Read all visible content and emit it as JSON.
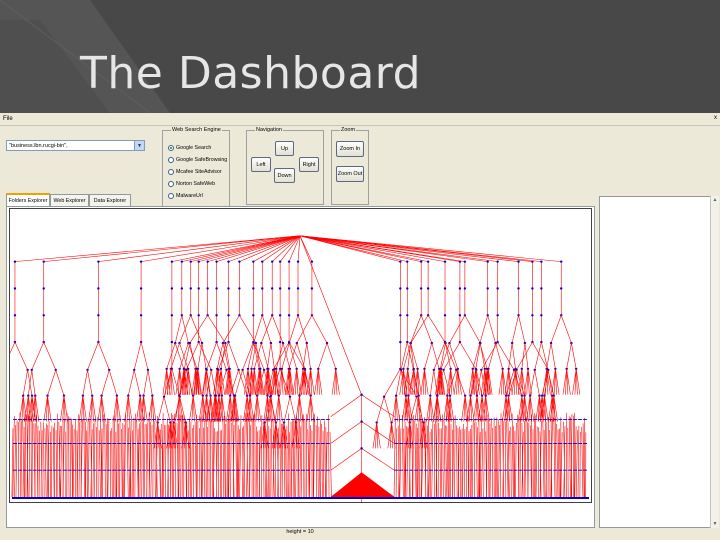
{
  "slide": {
    "title": "The Dashboard"
  },
  "menu": {
    "file": "File",
    "close": "x"
  },
  "url_field": {
    "value": "\"business.lbn.rucgi-bin\","
  },
  "search_engine": {
    "legend": "Web Search Engine",
    "options": [
      "Google Search",
      "Google SafeBrowsing",
      "Mcafee SiteAdvisor",
      "Norton SafeWeb",
      "MalwareUrl"
    ],
    "selected": "Google Search"
  },
  "navigation": {
    "legend": "Navigation",
    "up": "Up",
    "left": "Left",
    "right": "Right",
    "down": "Down"
  },
  "zoom": {
    "legend": "Zoom",
    "zoom_in": "Zoom In",
    "zoom_out": "Zoom Out"
  },
  "tabs": [
    "Folders Explorer",
    "Web Explorer",
    "Data Explorer"
  ],
  "active_tab": "Folders Explorer",
  "status": {
    "height_label": "height = 10"
  },
  "colors": {
    "edge": "#ff0000",
    "node": "#0000cc",
    "slide_bg": "#484848",
    "window_bg": "#ece9d8"
  }
}
